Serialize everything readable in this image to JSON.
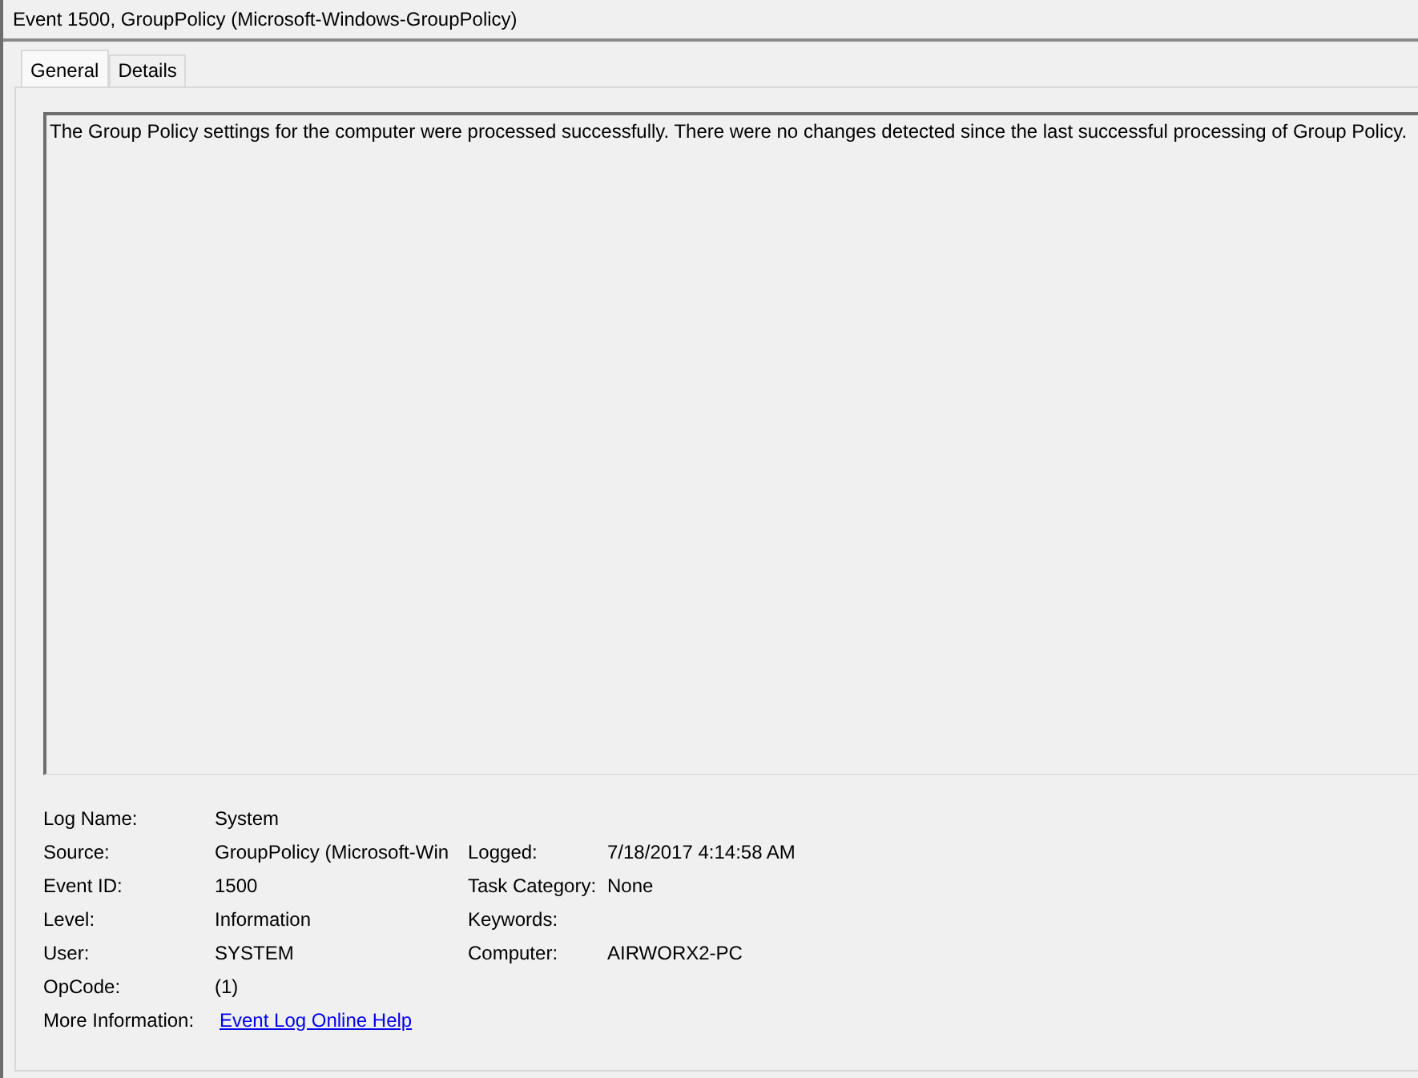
{
  "window": {
    "title": "Event 1500, GroupPolicy (Microsoft-Windows-GroupPolicy)"
  },
  "tabs": [
    {
      "label": "General",
      "selected": true
    },
    {
      "label": "Details",
      "selected": false
    }
  ],
  "description": "The Group Policy settings for the computer were processed successfully. There were no changes detected since the last successful processing of Group Policy.",
  "fields": [
    {
      "label": "Log Name:",
      "value": "System"
    },
    {
      "label": "Source:",
      "value": "GroupPolicy (Microsoft-Win",
      "right_label": "Logged:",
      "right_value": "7/18/2017 4:14:58 AM"
    },
    {
      "label": "Event ID:",
      "value": "1500",
      "right_label": "Task Category:",
      "right_value": "None"
    },
    {
      "label": "Level:",
      "value": "Information",
      "right_label": "Keywords:"
    },
    {
      "label": "User:",
      "value": "SYSTEM",
      "right_label": "Computer:",
      "right_value": "AIRWORX2-PC"
    },
    {
      "label": "OpCode:",
      "value": "(1)"
    },
    {
      "label": "More Information:",
      "value": "Event Log Online Help",
      "kind": "link"
    }
  ]
}
